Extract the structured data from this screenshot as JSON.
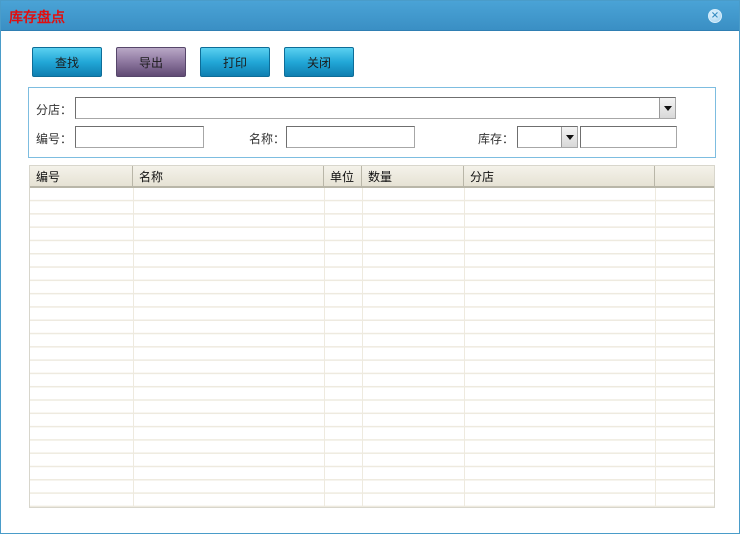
{
  "window": {
    "title": "库存盘点",
    "close_icon": "close-icon"
  },
  "toolbar": {
    "search_label": "查找",
    "export_label": "导出",
    "print_label": "打印",
    "close_label": "关闭"
  },
  "filters": {
    "branch_label": "分店：",
    "branch_value": "",
    "code_label": "编号：",
    "code_value": "",
    "name_label": "名称：",
    "name_value": "",
    "stock_label": "库存：",
    "stock_operator_value": "",
    "stock_value": ""
  },
  "table": {
    "columns": [
      "编号",
      "名称",
      "单位",
      "数量",
      "分店",
      ""
    ],
    "rows": []
  },
  "colors": {
    "title_text": "#e01010",
    "titlebar": "#3a8fc4",
    "button_blue": "#22a7d7",
    "button_purple": "#8d779f"
  }
}
